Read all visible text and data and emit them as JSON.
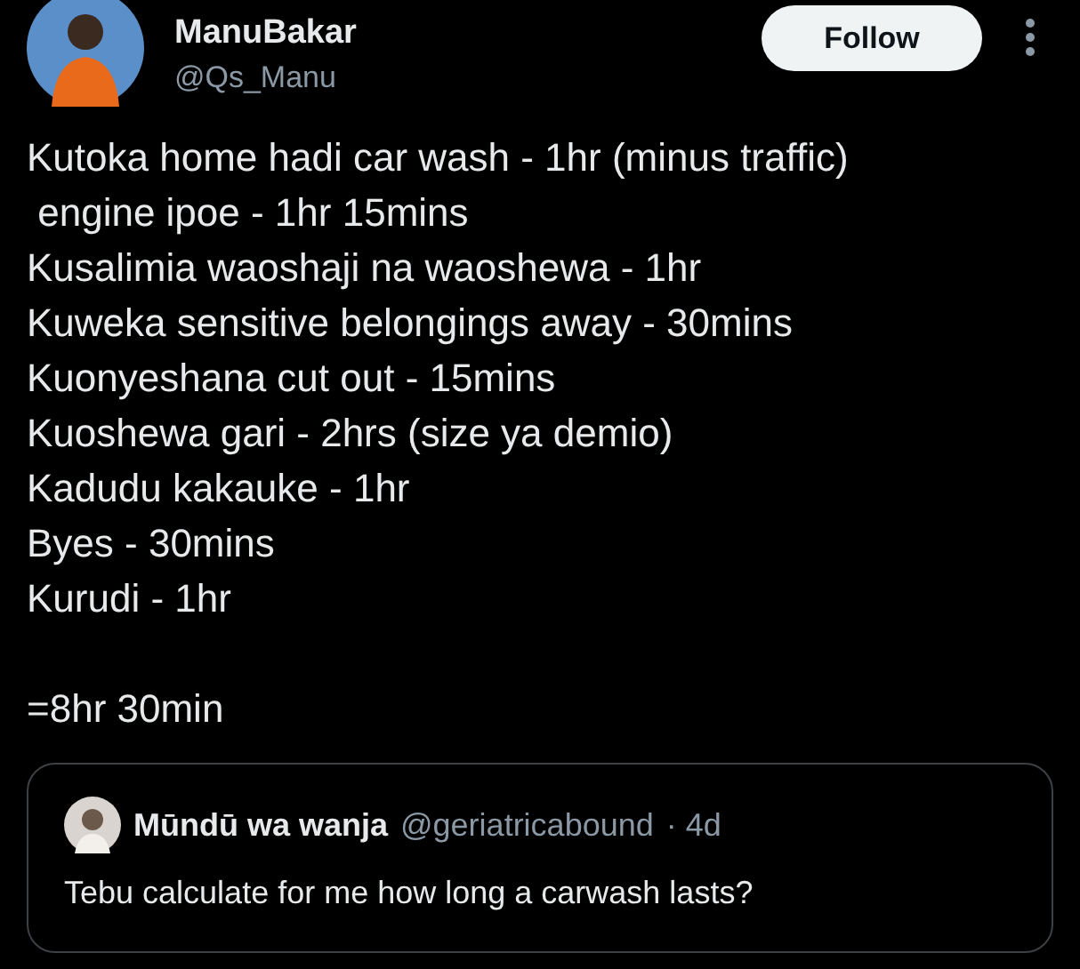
{
  "author": {
    "name": "ManuBakar",
    "handle": "@Qs_Manu"
  },
  "follow_button": "Follow",
  "lines": [
    "Kutoka home hadi car wash - 1hr (minus traffic)",
    " engine ipoe - 1hr 15mins",
    "Kusalimia waoshaji na waoshewa - 1hr",
    "Kuweka sensitive belongings away - 30mins",
    "Kuonyeshana cut out - 15mins",
    "Kuoshewa gari - 2hrs (size ya demio)",
    "Kadudu kakauke - 1hr",
    "Byes - 30mins",
    "Kurudi - 1hr"
  ],
  "total": "=8hr 30min",
  "quote": {
    "name": "Mūndū wa wanja",
    "handle": "@geriatricabound",
    "time": "· 4d",
    "text": "Tebu calculate for me how long a carwash lasts?"
  }
}
